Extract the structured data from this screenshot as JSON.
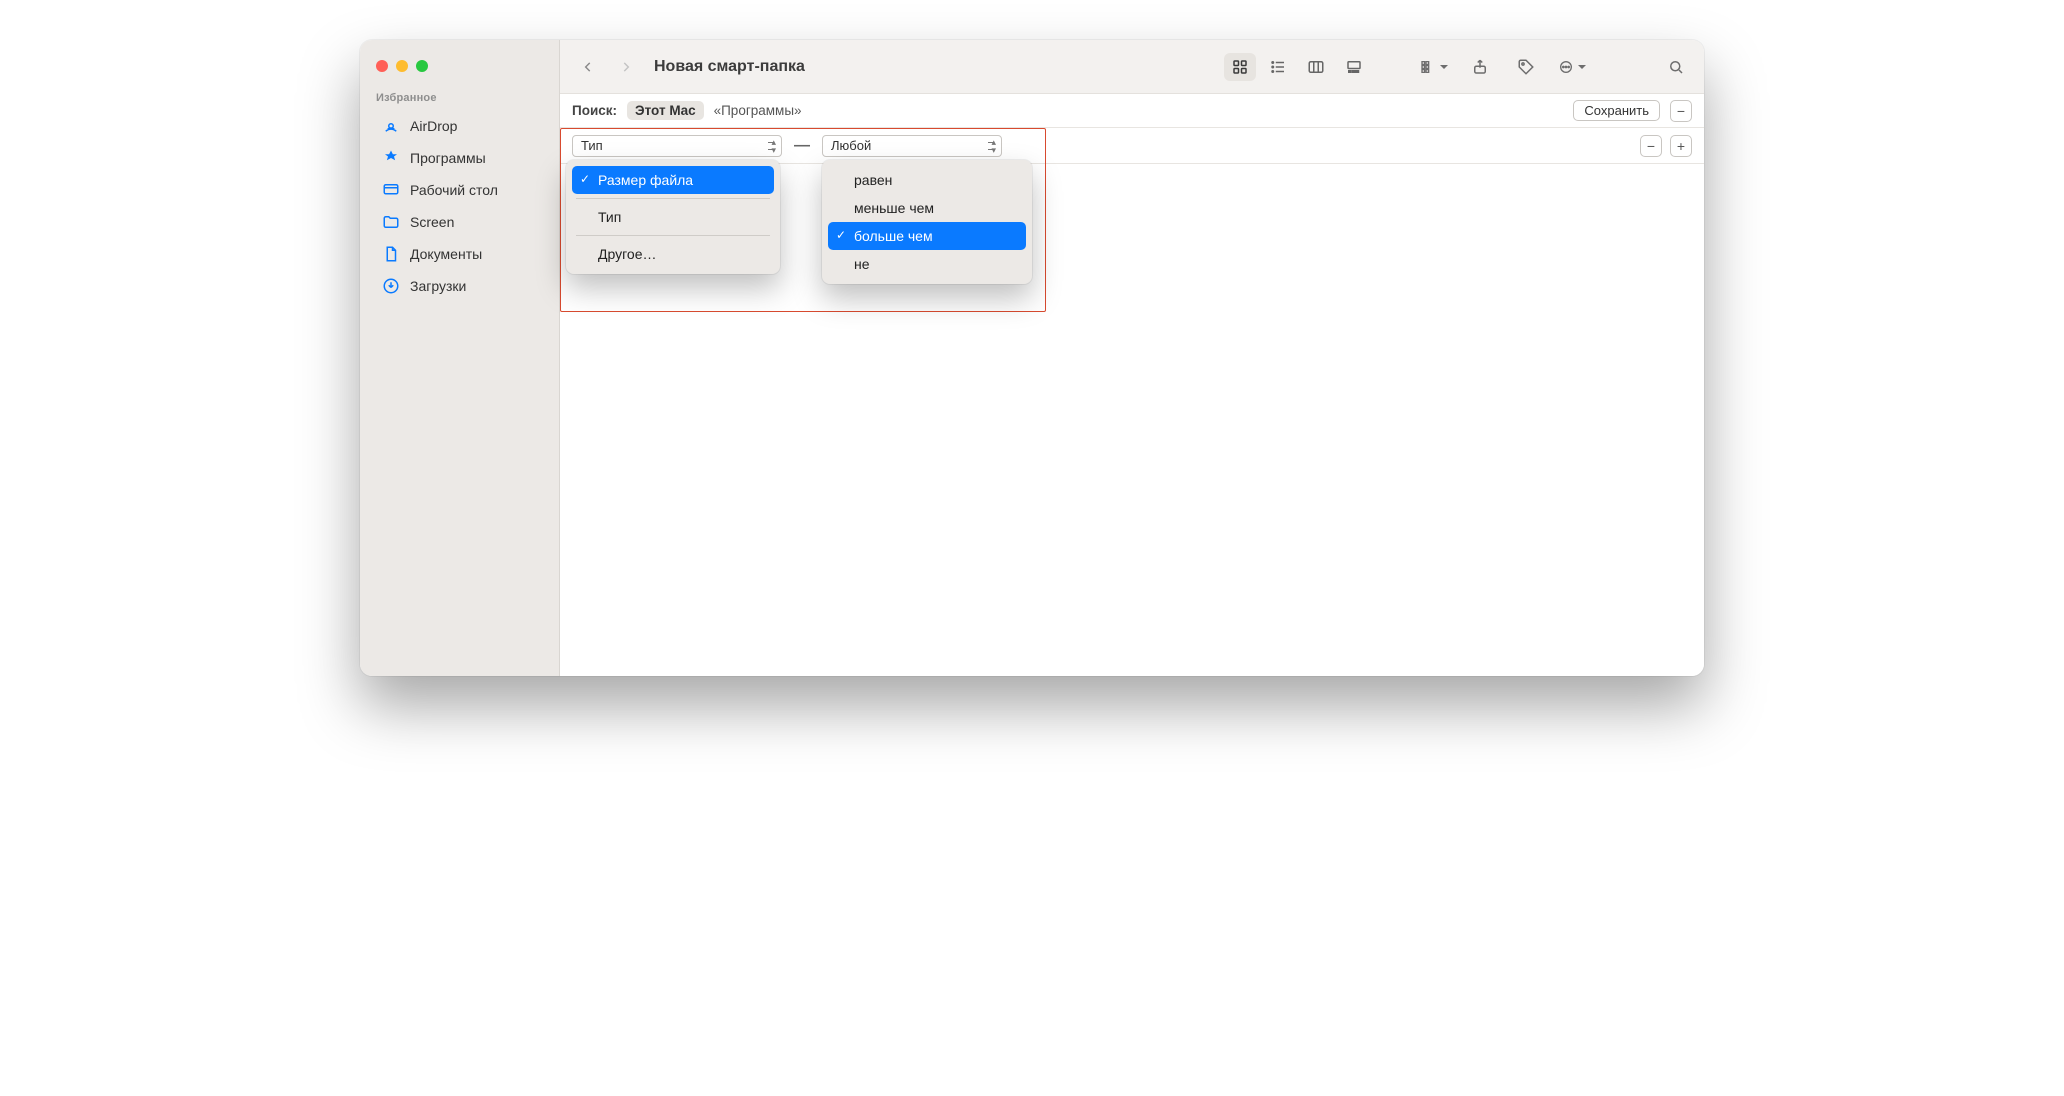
{
  "window": {
    "title": "Новая смарт-папка"
  },
  "sidebar": {
    "section_title": "Избранное",
    "items": [
      {
        "label": "AirDrop"
      },
      {
        "label": "Программы"
      },
      {
        "label": "Рабочий стол"
      },
      {
        "label": "Screen"
      },
      {
        "label": "Документы"
      },
      {
        "label": "Загрузки"
      }
    ]
  },
  "searchbar": {
    "label": "Поиск:",
    "scope_selected": "Этот Mac",
    "scope_other": "«Программы»",
    "save_label": "Сохранить"
  },
  "criteria": {
    "attribute_combo": "Тип",
    "dash": "—",
    "value_combo": "Любой"
  },
  "attribute_menu": {
    "items": [
      "Размер файла",
      "Тип",
      "Другое…"
    ],
    "selected_index": 0
  },
  "operator_menu": {
    "items": [
      "равен",
      "меньше чем",
      "больше чем",
      "не"
    ],
    "selected_index": 2
  }
}
